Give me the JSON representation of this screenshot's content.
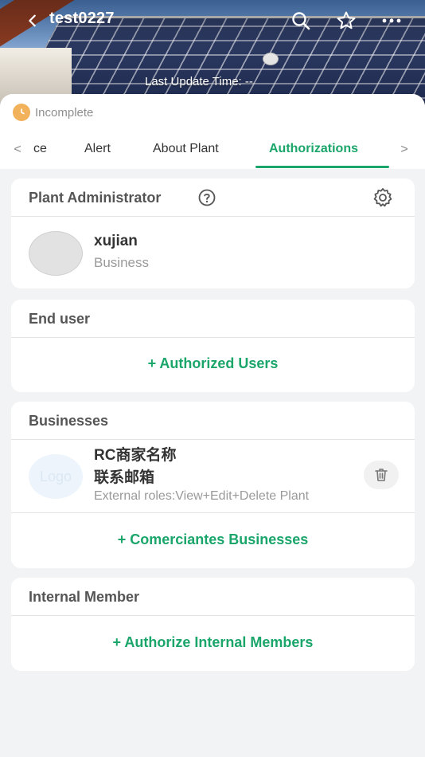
{
  "header": {
    "title": "test0227",
    "last_update_label": "Last Update Time: --"
  },
  "status": {
    "label": "Incomplete",
    "color": "#f2b25c"
  },
  "tabs": [
    {
      "label": "ce"
    },
    {
      "label": "Alert"
    },
    {
      "label": "About Plant"
    },
    {
      "label": "Authorizations",
      "active": true
    }
  ],
  "accent_color": "#1aa56a",
  "plant_admin": {
    "title": "Plant Administrator",
    "name": "xujian",
    "role": "Business"
  },
  "end_user": {
    "title": "End user",
    "add_label": "+ Authorized Users"
  },
  "businesses": {
    "title": "Businesses",
    "item": {
      "logo_text": "Logo",
      "name": "RC商家名称",
      "email": "联系邮箱",
      "roles": "External roles:View+Edit+Delete Plant"
    },
    "add_label": "+ Comerciantes Businesses"
  },
  "internal_member": {
    "title": "Internal Member",
    "add_label": "+ Authorize Internal Members"
  }
}
